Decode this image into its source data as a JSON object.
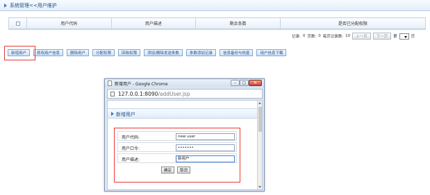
{
  "breadcrumb": {
    "title": "系统管理<<用户维护"
  },
  "table": {
    "columns": [
      "用户代码",
      "用户描述",
      "剩余条数",
      "是否已分配权限"
    ]
  },
  "pager": {
    "records_label": "记录:",
    "records_value": "0",
    "pages_label": "页数:",
    "pages_value": "0",
    "per_page_label": "每页记录数:",
    "per_page_value": "10",
    "prev": "上一页",
    "next": "下一页",
    "page_prefix": "第",
    "page_suffix": "页"
  },
  "actions": [
    "新增用户",
    "修改用户信息",
    "删除用户",
    "分配权限",
    "回收权限",
    "添加/删除发送条数",
    "条数添加记录",
    "信息备份与恢复",
    "用户信息下载"
  ],
  "popup": {
    "title": "新增用户 - Google Chrome",
    "url_host": "127.0.0.1:8090",
    "url_path": "/addUser.jsp",
    "section_title": "新增用户",
    "fields": {
      "code_label": "用户代码:",
      "code_value": "new user",
      "password_label": "用户口令:",
      "password_value": "•••••••",
      "desc_label": "用户描述:",
      "desc_value": "新用户"
    },
    "ok": "确定",
    "cancel": "取消"
  },
  "colors": {
    "highlight": "#e53935",
    "accent": "#3a78c2"
  }
}
